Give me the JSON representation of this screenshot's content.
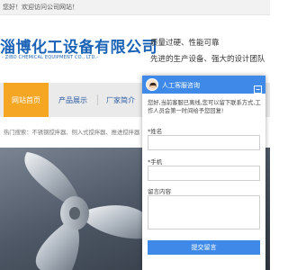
{
  "topbar": {
    "welcome_text": "您好！欢迎访问公司网站！"
  },
  "header": {
    "company_name": "淄博化工设备有限公司",
    "company_name_en": "- ZIBO CHEMICAL EQUIPMENT CO., LTD.-",
    "slogans": [
      "质量过硬、性能可靠",
      "先进的生产设备、强大的设计团队"
    ]
  },
  "nav": {
    "items": [
      {
        "label": "网站首页",
        "active": true
      },
      {
        "label": "产品展示",
        "active": false
      },
      {
        "label": "厂家简介",
        "active": false
      }
    ],
    "colors": {
      "active_bg": "#f5a623",
      "text": "#2e5fa6"
    }
  },
  "hot_search": {
    "text": "热门搜索：不锈钢搅拌器、侧入式搅拌器、推进搅拌器"
  },
  "chat": {
    "title": "人工客服咨询",
    "intro": "您好,当前客服已离线,您可以留下联系方式,工作人员会第一时间给予您回复!",
    "name_label": "*姓名",
    "phone_label": "*手机",
    "message_label": "留言内容",
    "submit_label": "提交留言",
    "colors": {
      "header_bg": "#3f8ae8",
      "button_bg": "#3f8ae8"
    },
    "icons": {
      "minimize": "minimize-icon",
      "avatar": "agent-avatar-icon"
    }
  }
}
